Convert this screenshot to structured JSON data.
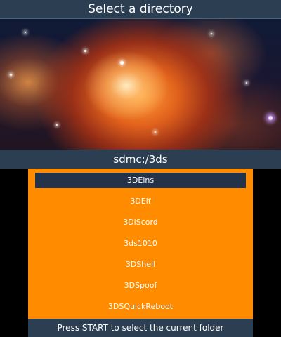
{
  "top": {
    "title": "Select a directory",
    "path": "sdmc:/3ds"
  },
  "wallpaper": {
    "description_icon": "nebula-wallpaper"
  },
  "directories": [
    {
      "name": "3DEins",
      "selected": true
    },
    {
      "name": "3DElf",
      "selected": false
    },
    {
      "name": "3DiScord",
      "selected": false
    },
    {
      "name": "3ds1010",
      "selected": false
    },
    {
      "name": "3DShell",
      "selected": false
    },
    {
      "name": "3DSpoof",
      "selected": false
    },
    {
      "name": "3DSQuickReboot",
      "selected": false
    }
  ],
  "bottom": {
    "hint": "Press START to select the current folder"
  },
  "colors": {
    "bar": "#2c3e52",
    "list_background": "#ff8c00",
    "selection": "#24324a",
    "text": "#ffffff"
  }
}
